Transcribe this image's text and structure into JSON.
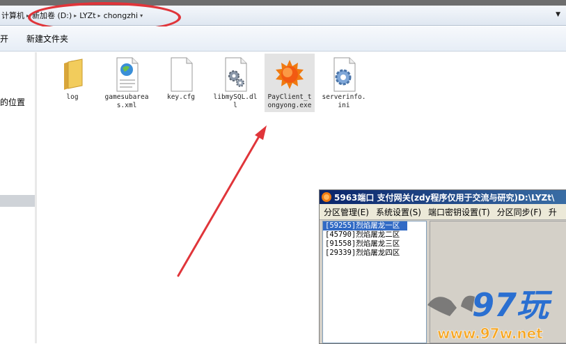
{
  "explorer": {
    "address_crumbs": [
      "计算机",
      "新加卷 (D:)",
      "LYZt",
      "chongzhi"
    ],
    "toolbar": {
      "open_label": "开",
      "new_folder_label": "新建文件夹"
    },
    "nav": {
      "location_label": "的位置"
    },
    "files": [
      {
        "name": "log",
        "icon": "folder-icon"
      },
      {
        "name": "gamesubareas.xml",
        "icon": "xml-file-icon"
      },
      {
        "name": "key.cfg",
        "icon": "blank-file-icon"
      },
      {
        "name": "libmySQL.dll",
        "icon": "dll-file-icon"
      },
      {
        "name": "PayClient_tongyong.exe",
        "icon": "sun-app-icon"
      },
      {
        "name": "serverinfo.ini",
        "icon": "ini-file-icon"
      }
    ]
  },
  "app_window": {
    "title": "5963端口 支付网关(zdy程序仅用于交流与研究)D:\\LYZt\\",
    "menu": [
      "分区管理(E)",
      "系统设置(S)",
      "端口密钥设置(T)",
      "分区同步(F)",
      "升"
    ],
    "servers": [
      "[59255]烈焰屠龙一区",
      "[45790]烈焰屠龙二区",
      "[91558]烈焰屠龙三区",
      "[29339]烈焰屠龙四区"
    ],
    "selected_index": 0
  },
  "watermark": {
    "brand": "97玩",
    "url": "www.97w.net"
  },
  "colors": {
    "annotation": "#e0353a",
    "title_bar": "#0a246a",
    "selection": "#316ac5"
  }
}
